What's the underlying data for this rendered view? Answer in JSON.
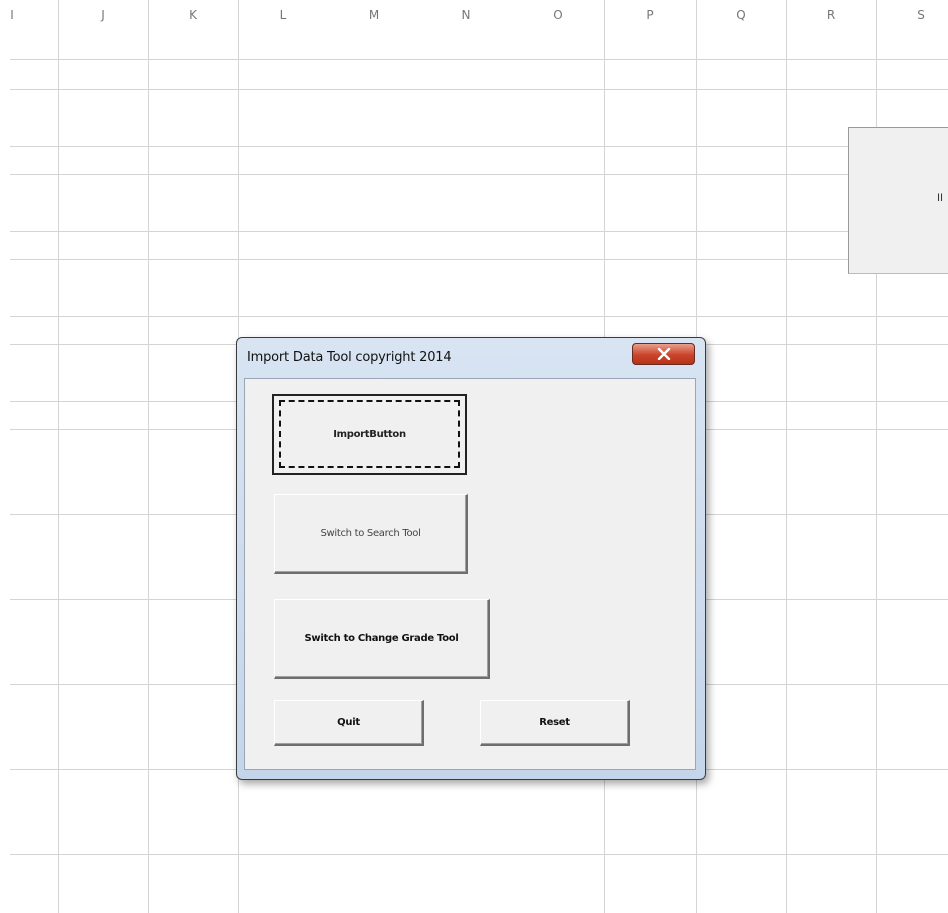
{
  "spreadsheet": {
    "columns": [
      "I",
      "J",
      "K",
      "L",
      "M",
      "N",
      "O",
      "P",
      "Q",
      "R",
      "S"
    ]
  },
  "side_shape": {
    "text": "II"
  },
  "dialog": {
    "title": "Import Data Tool copyright 2014",
    "close_icon": "close-x-icon",
    "buttons": {
      "import": "ImportButton",
      "search": "Switch to Search Tool",
      "change_grade": "Switch to Change Grade Tool",
      "quit": "Quit",
      "reset": "Reset"
    }
  },
  "colors": {
    "gridline": "#d4d4d4",
    "dialog_frame": "#c4d5ea",
    "close_button": "#c9442a",
    "button_face": "#f0f0f0"
  }
}
